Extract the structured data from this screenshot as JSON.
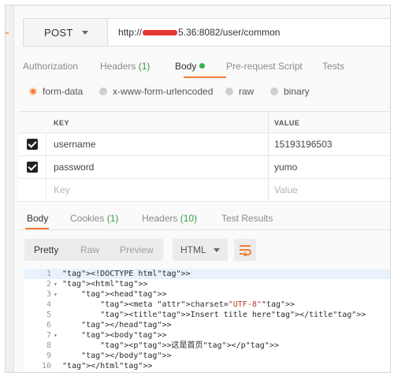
{
  "request": {
    "method": "POST",
    "url_prefix": "http://",
    "url_suffix": "5.36:8082/user/common"
  },
  "request_tabs": [
    {
      "label": "Authorization",
      "count": ""
    },
    {
      "label": "Headers",
      "count": "(1)"
    },
    {
      "label": "Body",
      "count": ""
    },
    {
      "label": "Pre-request Script",
      "count": ""
    },
    {
      "label": "Tests",
      "count": ""
    }
  ],
  "body_types": [
    "form-data",
    "x-www-form-urlencoded",
    "raw",
    "binary"
  ],
  "params": {
    "key_header": "KEY",
    "value_header": "VALUE",
    "rows": [
      {
        "key": "username",
        "value": "15193196503"
      },
      {
        "key": "password",
        "value": "yumo"
      }
    ],
    "key_placeholder": "Key",
    "value_placeholder": "Value"
  },
  "response_tabs": [
    {
      "label": "Body",
      "count": ""
    },
    {
      "label": "Cookies",
      "count": "(1)"
    },
    {
      "label": "Headers",
      "count": "(10)"
    },
    {
      "label": "Test Results",
      "count": ""
    }
  ],
  "view_modes": [
    "Pretty",
    "Raw",
    "Preview"
  ],
  "format": "HTML",
  "code_lines": [
    {
      "num": "1",
      "fold": "",
      "text": "<!DOCTYPE html>"
    },
    {
      "num": "2",
      "fold": "▾",
      "text": "<html>"
    },
    {
      "num": "3",
      "fold": "▾",
      "text": "    <head>"
    },
    {
      "num": "4",
      "fold": "",
      "text": "        <meta charset=\"UTF-8\">"
    },
    {
      "num": "5",
      "fold": "",
      "text": "        <title>Insert title here</title>"
    },
    {
      "num": "6",
      "fold": "",
      "text": "    </head>"
    },
    {
      "num": "7",
      "fold": "▾",
      "text": "    <body>"
    },
    {
      "num": "8",
      "fold": "",
      "text": "        <p>这是首页</p>"
    },
    {
      "num": "9",
      "fold": "",
      "text": "    </body>"
    },
    {
      "num": "10",
      "fold": "",
      "text": "</html>"
    }
  ],
  "colors": {
    "accent": "#f47d37",
    "green": "#2fb34a",
    "redaction": "#e53935"
  }
}
